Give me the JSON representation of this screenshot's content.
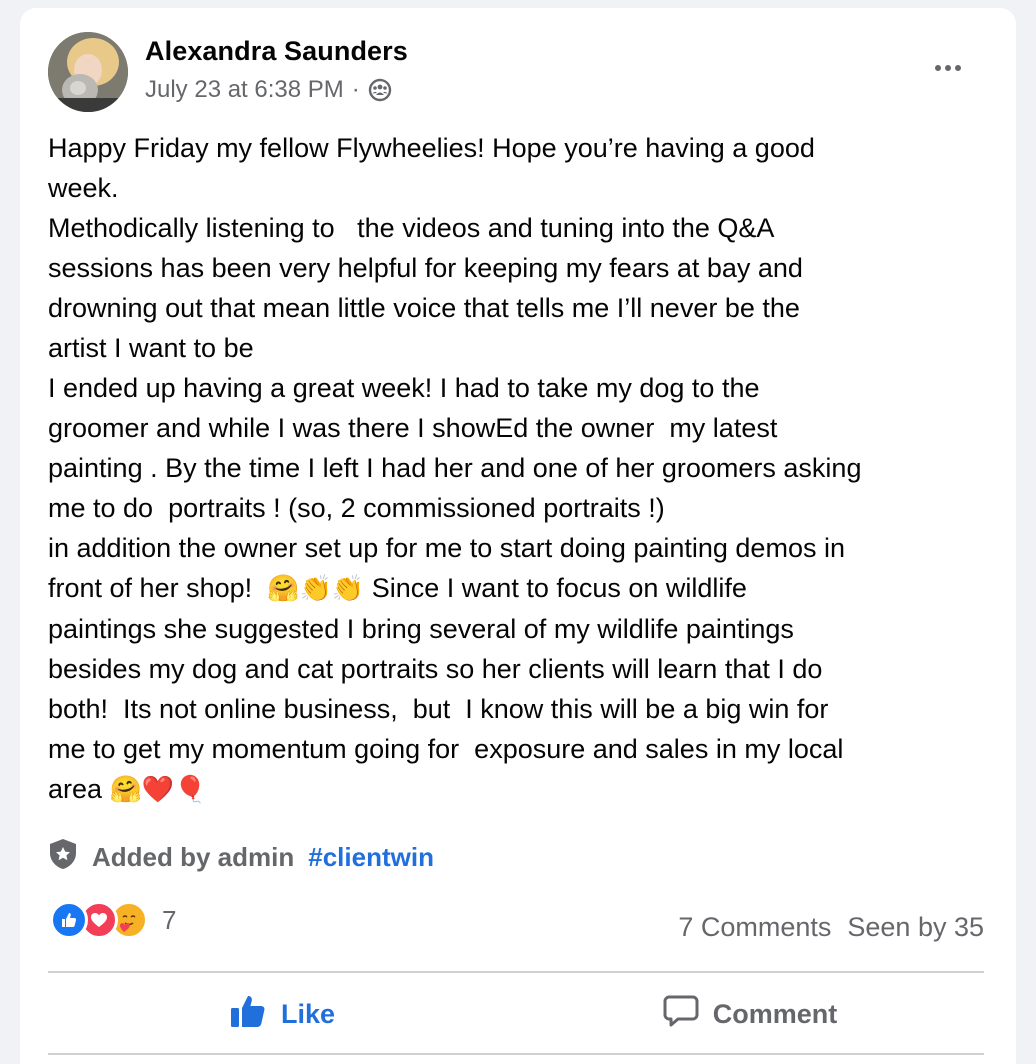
{
  "post": {
    "author": "Alexandra Saunders",
    "timestamp": "July 23 at 6:38 PM",
    "separator": "·",
    "body_lines": [
      "Happy Friday my fellow Flywheelies! Hope you’re having a good",
      "week.",
      "Methodically listening to   the videos and tuning into the Q&A",
      "sessions has been very helpful for keeping my fears at bay and",
      "drowning out that mean little voice that tells me I’ll never be the",
      "artist I want to be",
      "I ended up having a great week! I had to take my dog to the",
      "groomer and while I was there I showEd the owner  my latest",
      "painting . By the time I left I had her and one of her groomers asking",
      "me to do  portraits ! (so, 2 commissioned portraits !)",
      "in addition the owner set up for me to start doing painting demos in"
    ],
    "line12_start": "front of her shop!  ",
    "line12_emojis": "🤗👏👏",
    "line12_end": " Since I want to focus on wildlife",
    "body_lines_after": [
      "paintings she suggested I bring several of my wildlife paintings",
      "besides my dog and cat portraits so her clients will learn that I do",
      "both!  Its not online business,  but  I know this will be a big win for",
      "me to get my momentum going for  exposure and sales in my local"
    ],
    "last_line_text": "area ",
    "last_line_emojis": "🤗❤️🎈"
  },
  "admin": {
    "label": "Added by admin",
    "hashtag": "#clientwin"
  },
  "reactions": {
    "count": "7",
    "types": [
      "like",
      "love",
      "care"
    ]
  },
  "stats": {
    "comments": "7 Comments",
    "seen": "Seen by 35"
  },
  "actions": {
    "like_label": "Like",
    "comment_label": "Comment"
  },
  "colors": {
    "accent": "#216fdb",
    "muted": "#65676b",
    "like_blue": "#1877f2",
    "love_red": "#f33e58",
    "care_yellow": "#f7b125"
  },
  "icons": {
    "group_privacy": "group-icon",
    "more": "more-icon",
    "admin_badge": "shield-star-icon",
    "like": "thumbs-up-icon",
    "comment": "speech-bubble-icon"
  }
}
